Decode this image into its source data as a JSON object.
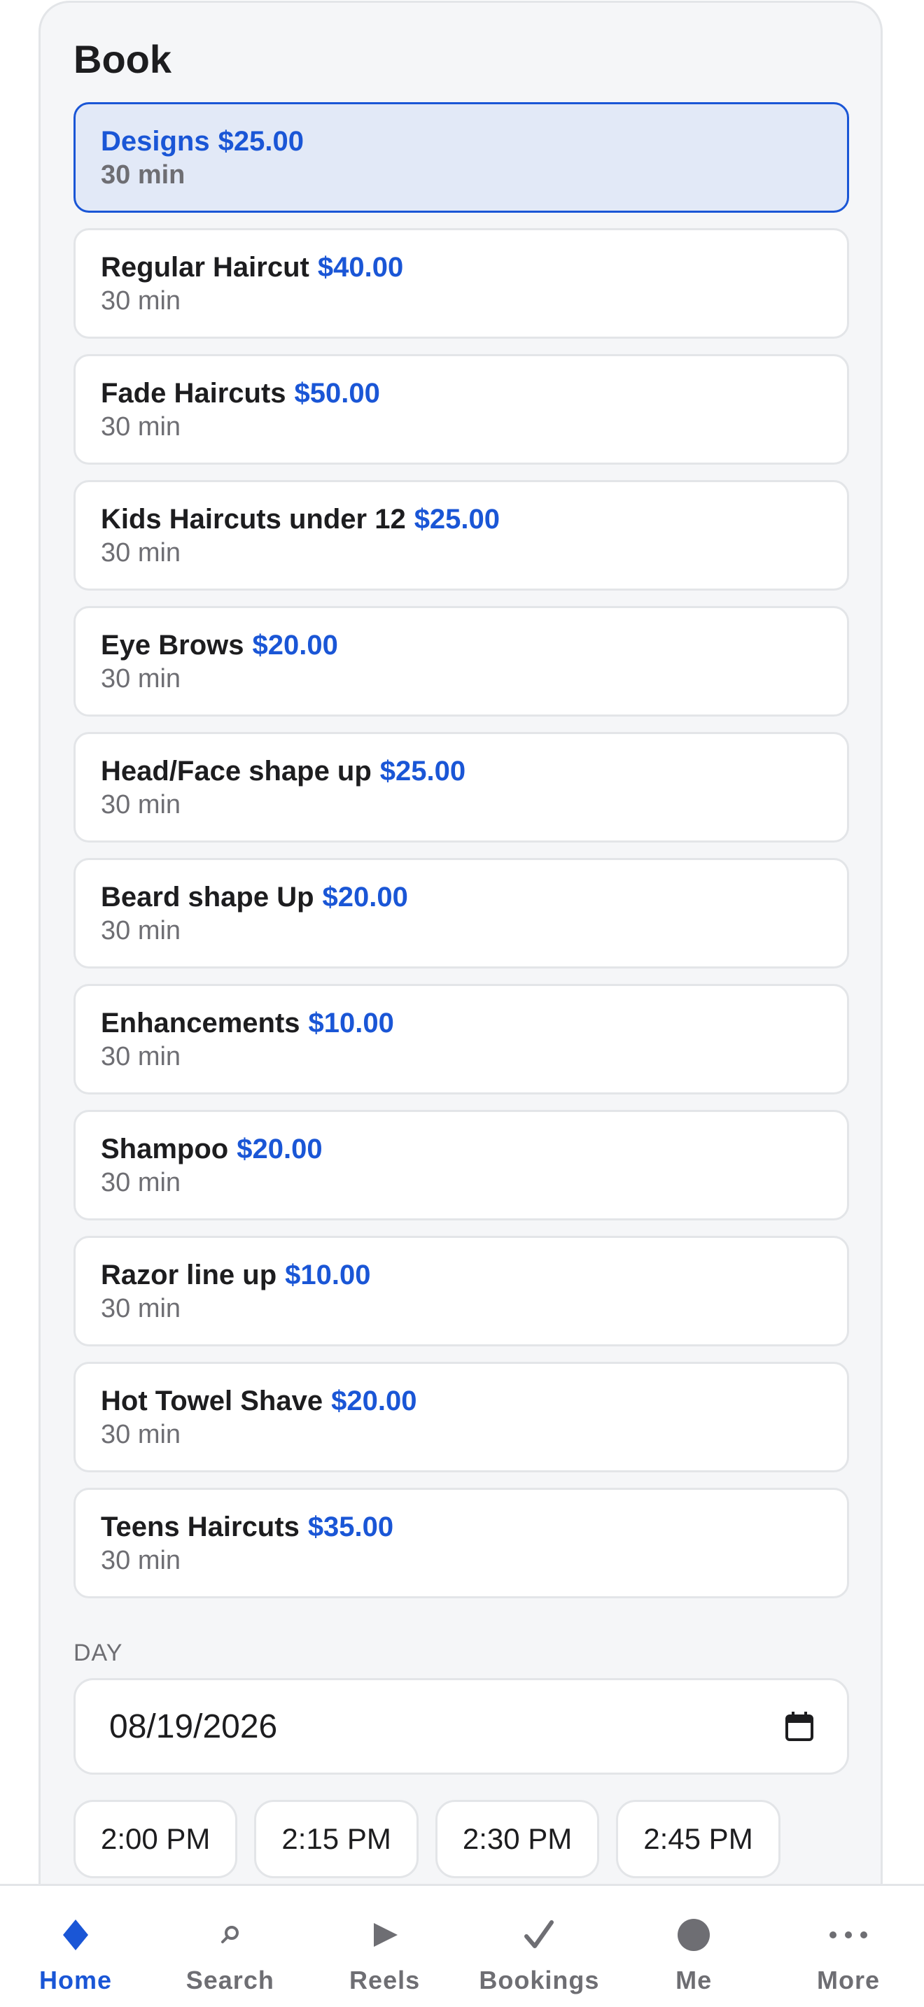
{
  "header": {
    "title": "Book"
  },
  "services": [
    {
      "name": "Designs",
      "price": "$25.00",
      "duration": "30 min",
      "selected": true
    },
    {
      "name": "Regular Haircut",
      "price": "$40.00",
      "duration": "30 min"
    },
    {
      "name": "Fade Haircuts",
      "price": "$50.00",
      "duration": "30 min"
    },
    {
      "name": "Kids Haircuts under 12",
      "price": "$25.00",
      "duration": "30 min"
    },
    {
      "name": "Eye Brows",
      "price": "$20.00",
      "duration": "30 min"
    },
    {
      "name": "Head/Face shape up",
      "price": "$25.00",
      "duration": "30 min"
    },
    {
      "name": "Beard shape Up",
      "price": "$20.00",
      "duration": "30 min"
    },
    {
      "name": "Enhancements",
      "price": "$10.00",
      "duration": "30 min"
    },
    {
      "name": "Shampoo",
      "price": "$20.00",
      "duration": "30 min"
    },
    {
      "name": "Razor line up",
      "price": "$10.00",
      "duration": "30 min"
    },
    {
      "name": "Hot Towel Shave",
      "price": "$20.00",
      "duration": "30 min"
    },
    {
      "name": "Teens Haircuts",
      "price": "$35.00",
      "duration": "30 min"
    }
  ],
  "day": {
    "label": "DAY",
    "value": "08/19/2026",
    "icon": "calendar-icon"
  },
  "times": [
    "2:00 PM",
    "2:15 PM",
    "2:30 PM",
    "2:45 PM"
  ],
  "tabbar": {
    "items": [
      {
        "label": "Home",
        "icon": "home-icon",
        "active": true
      },
      {
        "label": "Search",
        "icon": "search-icon"
      },
      {
        "label": "Reels",
        "icon": "play-icon"
      },
      {
        "label": "Bookings",
        "icon": "check-icon"
      },
      {
        "label": "Me",
        "icon": "profile-icon"
      },
      {
        "label": "More",
        "icon": "more-icon"
      }
    ]
  },
  "colors": {
    "accent": "#1a56d6",
    "selected_bg": "#e2e9f7",
    "muted_text": "#6e6e73",
    "panel_bg": "#f5f6f8",
    "border": "#e3e5e8"
  }
}
